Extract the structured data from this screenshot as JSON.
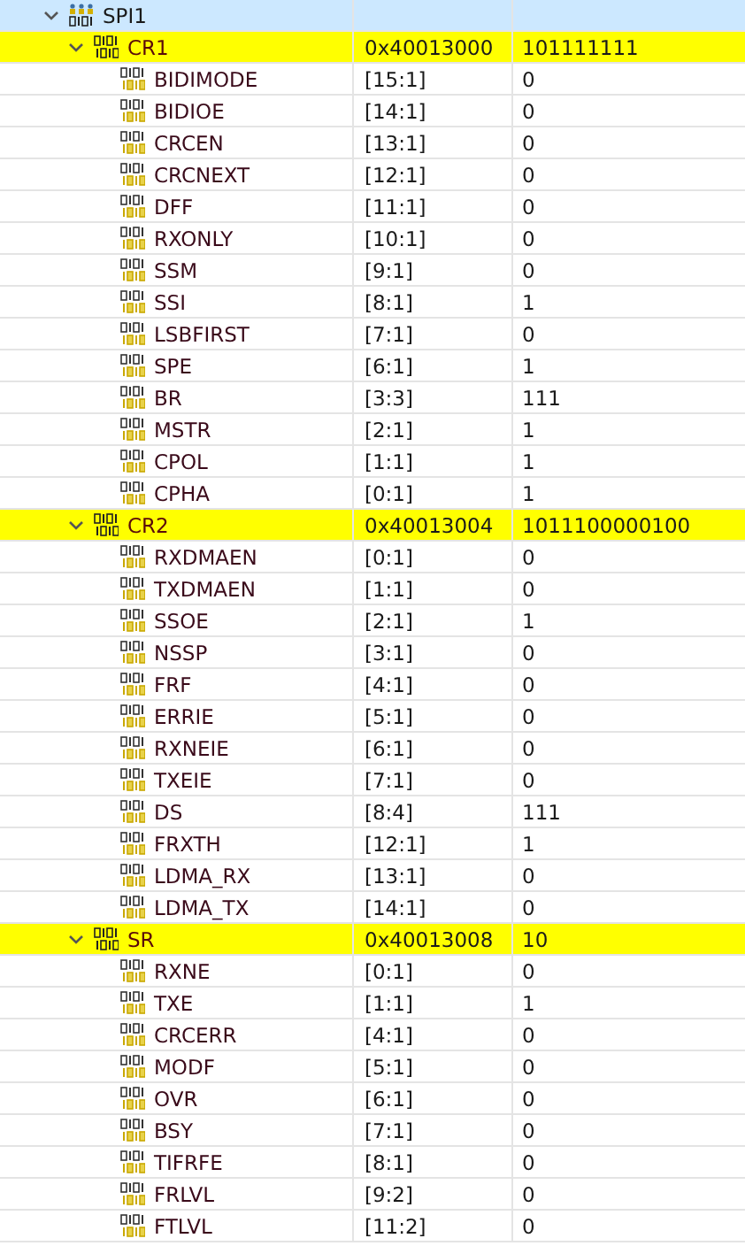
{
  "peripheral": {
    "name": "SPI1",
    "expanded": true,
    "selected": true,
    "registers": [
      {
        "name": "CR1",
        "address": "0x40013000",
        "value": "101111111",
        "expanded": true,
        "highlighted": true,
        "fields": [
          {
            "name": "BIDIMODE",
            "bits": "[15:1]",
            "value": "0"
          },
          {
            "name": "BIDIOE",
            "bits": "[14:1]",
            "value": "0"
          },
          {
            "name": "CRCEN",
            "bits": "[13:1]",
            "value": "0"
          },
          {
            "name": "CRCNEXT",
            "bits": "[12:1]",
            "value": "0"
          },
          {
            "name": "DFF",
            "bits": "[11:1]",
            "value": "0"
          },
          {
            "name": "RXONLY",
            "bits": "[10:1]",
            "value": "0"
          },
          {
            "name": "SSM",
            "bits": "[9:1]",
            "value": "0"
          },
          {
            "name": "SSI",
            "bits": "[8:1]",
            "value": "1"
          },
          {
            "name": "LSBFIRST",
            "bits": "[7:1]",
            "value": "0"
          },
          {
            "name": "SPE",
            "bits": "[6:1]",
            "value": "1"
          },
          {
            "name": "BR",
            "bits": "[3:3]",
            "value": "111"
          },
          {
            "name": "MSTR",
            "bits": "[2:1]",
            "value": "1"
          },
          {
            "name": "CPOL",
            "bits": "[1:1]",
            "value": "1"
          },
          {
            "name": "CPHA",
            "bits": "[0:1]",
            "value": "1"
          }
        ]
      },
      {
        "name": "CR2",
        "address": "0x40013004",
        "value": "1011100000100",
        "expanded": true,
        "highlighted": true,
        "fields": [
          {
            "name": "RXDMAEN",
            "bits": "[0:1]",
            "value": "0"
          },
          {
            "name": "TXDMAEN",
            "bits": "[1:1]",
            "value": "0"
          },
          {
            "name": "SSOE",
            "bits": "[2:1]",
            "value": "1"
          },
          {
            "name": "NSSP",
            "bits": "[3:1]",
            "value": "0"
          },
          {
            "name": "FRF",
            "bits": "[4:1]",
            "value": "0"
          },
          {
            "name": "ERRIE",
            "bits": "[5:1]",
            "value": "0"
          },
          {
            "name": "RXNEIE",
            "bits": "[6:1]",
            "value": "0"
          },
          {
            "name": "TXEIE",
            "bits": "[7:1]",
            "value": "0"
          },
          {
            "name": "DS",
            "bits": "[8:4]",
            "value": "111"
          },
          {
            "name": "FRXTH",
            "bits": "[12:1]",
            "value": "1"
          },
          {
            "name": "LDMA_RX",
            "bits": "[13:1]",
            "value": "0"
          },
          {
            "name": "LDMA_TX",
            "bits": "[14:1]",
            "value": "0"
          }
        ]
      },
      {
        "name": "SR",
        "address": "0x40013008",
        "value": "10",
        "expanded": true,
        "highlighted": true,
        "fields": [
          {
            "name": "RXNE",
            "bits": "[0:1]",
            "value": "0"
          },
          {
            "name": "TXE",
            "bits": "[1:1]",
            "value": "1"
          },
          {
            "name": "CRCERR",
            "bits": "[4:1]",
            "value": "0"
          },
          {
            "name": "MODF",
            "bits": "[5:1]",
            "value": "0"
          },
          {
            "name": "OVR",
            "bits": "[6:1]",
            "value": "0"
          },
          {
            "name": "BSY",
            "bits": "[7:1]",
            "value": "0"
          },
          {
            "name": "TIFRFE",
            "bits": "[8:1]",
            "value": "0"
          },
          {
            "name": "FRLVL",
            "bits": "[9:2]",
            "value": "0"
          },
          {
            "name": "FTLVL",
            "bits": "[11:2]",
            "value": "0"
          }
        ]
      }
    ]
  }
}
